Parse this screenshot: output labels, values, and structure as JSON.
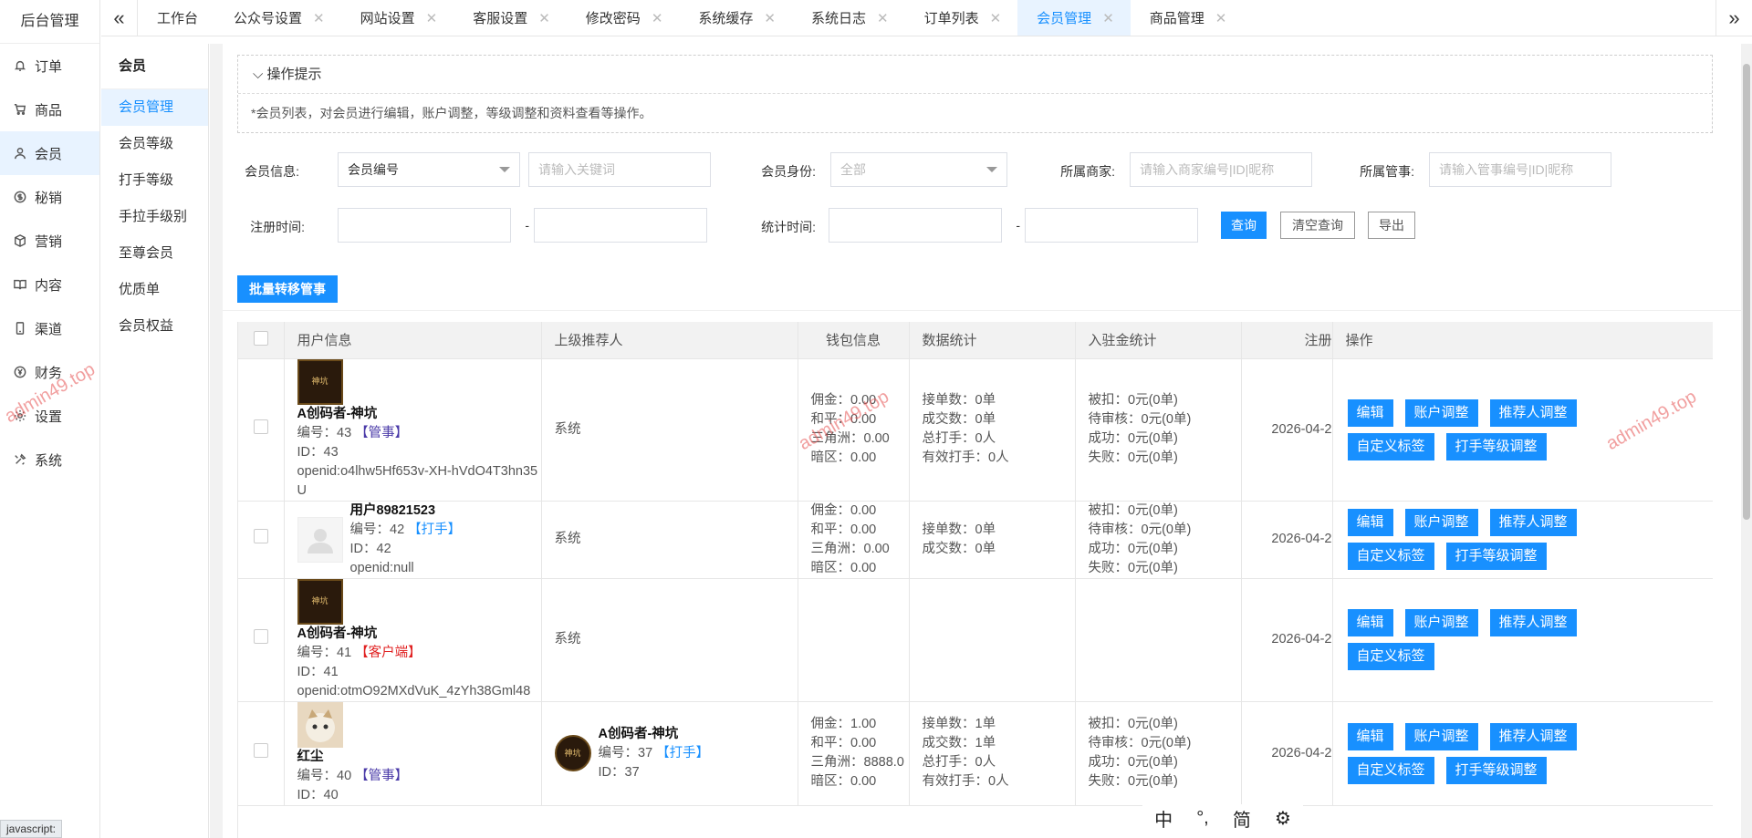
{
  "brand": "后台管理",
  "nav": [
    {
      "label": "订单",
      "icon": "bell-icon"
    },
    {
      "label": "商品",
      "icon": "cart-icon"
    },
    {
      "label": "会员",
      "icon": "user-icon",
      "active": true
    },
    {
      "label": "秘销",
      "icon": "dollar-icon"
    },
    {
      "label": "营销",
      "icon": "box-icon"
    },
    {
      "label": "内容",
      "icon": "book-icon"
    },
    {
      "label": "渠道",
      "icon": "phone-icon"
    },
    {
      "label": "财务",
      "icon": "yen-icon"
    },
    {
      "label": "设置",
      "icon": "gear-icon"
    },
    {
      "label": "系统",
      "icon": "tools-icon"
    }
  ],
  "subnav": {
    "title": "会员",
    "items": [
      "会员管理",
      "会员等级",
      "打手等级",
      "手拉手级别",
      "至尊会员",
      "优质单",
      "会员权益"
    ]
  },
  "tabs": [
    "工作台",
    "公众号设置",
    "网站设置",
    "客服设置",
    "修改密码",
    "系统缓存",
    "系统日志",
    "订单列表",
    "会员管理",
    "商品管理"
  ],
  "tips": {
    "title": "操作提示",
    "body": "*会员列表，对会员进行编辑，账户调整，等级调整和资料查看等操作。"
  },
  "filters": {
    "member_info_label": "会员信息:",
    "member_info_select": "会员编号",
    "keyword_placeholder": "请输入关键词",
    "identity_label": "会员身份:",
    "identity_select": "全部",
    "merchant_label": "所属商家:",
    "merchant_placeholder": "请输入商家编号|ID|昵称",
    "manager_label": "所属管事:",
    "manager_placeholder": "请输入管事编号|ID|昵称",
    "reg_time_label": "注册时间:",
    "stat_time_label": "统计时间:",
    "dash": "-",
    "query": "查询",
    "clear": "清空查询",
    "export": "导出"
  },
  "batch_button": "批量转移管事",
  "columns": [
    "用户信息",
    "上级推荐人",
    "钱包信息",
    "数据统计",
    "入驻金统计",
    "注册",
    "操作"
  ],
  "rows": [
    {
      "avatar": "game",
      "name": "A创码者-神坑",
      "no": "编号：43",
      "tag": "【管事】",
      "tagType": "purple",
      "id": "ID：43",
      "openid": "openid:o4lhw5Hf653v-XH-hVdO4T3hn35U",
      "ref": "系统",
      "wallet": [
        "佣金：0.00",
        "和平：0.00",
        "三角洲：0.00",
        "暗区：0.00"
      ],
      "stats": [
        "接单数：0单",
        "成交数：0单",
        "总打手：0人",
        "有效打手：0人"
      ],
      "settle": [
        "被扣：0元(0单)",
        "待审核：0元(0单)",
        "成功：0元(0单)",
        "失败：0元(0单)"
      ],
      "reg": "2026-04-2",
      "ops": [
        "编辑",
        "账户调整",
        "推荐人调整",
        "自定义标签",
        "打手等级调整"
      ]
    },
    {
      "avatar": "blank",
      "name": "用户89821523",
      "no": "编号：42",
      "tag": "【打手】",
      "tagType": "blue",
      "id": "ID：42",
      "openid": "openid:null",
      "ref": "系统",
      "wallet": [
        "佣金：0.00",
        "和平：0.00",
        "三角洲：0.00",
        "暗区：0.00"
      ],
      "stats": [
        "接单数：0单",
        "成交数：0单"
      ],
      "settle": [
        "被扣：0元(0单)",
        "待审核：0元(0单)",
        "成功：0元(0单)",
        "失败：0元(0单)"
      ],
      "reg": "2026-04-2",
      "ops": [
        "编辑",
        "账户调整",
        "推荐人调整",
        "自定义标签",
        "打手等级调整"
      ]
    },
    {
      "avatar": "game",
      "name": "A创码者-神坑",
      "no": "编号：41",
      "tag": "【客户端】",
      "tagType": "red",
      "id": "ID：41",
      "openid": "openid:otmO92MXdVuK_4zYh38Gml48",
      "ref": "系统",
      "wallet": [],
      "stats": [],
      "settle": [],
      "reg": "2026-04-2",
      "ops": [
        "编辑",
        "账户调整",
        "推荐人调整",
        "自定义标签"
      ]
    },
    {
      "avatar": "cat",
      "name": "红尘",
      "no": "编号：40",
      "tag": "【管事】",
      "tagType": "purple",
      "id": "ID：40",
      "openid": "",
      "refUser": {
        "name": "A创码者-神坑",
        "no": "编号：37",
        "tag": "【打手】",
        "id": "ID：37"
      },
      "wallet": [
        "佣金：1.00",
        "和平：0.00",
        "三角洲：8888.0",
        "暗区：0.00"
      ],
      "stats": [
        "接单数：1单",
        "成交数：1单",
        "总打手：0人",
        "有效打手：0人"
      ],
      "settle": [
        "被扣：0元(0单)",
        "待审核：0元(0单)",
        "成功：0元(0单)",
        "失败：0元(0单)"
      ],
      "reg": "2026-04-2",
      "ops": [
        "编辑",
        "账户调整",
        "推荐人调整",
        "自定义标签",
        "打手等级调整"
      ]
    }
  ],
  "watermark": "admin49.top",
  "status": "javascript:",
  "ime": [
    "中",
    "°,",
    "简"
  ],
  "colors": {
    "primary": "#1890ff",
    "active_bg": "#e8f3ff",
    "tag_red": "#e02020",
    "tag_purple": "#4a3aa8"
  }
}
